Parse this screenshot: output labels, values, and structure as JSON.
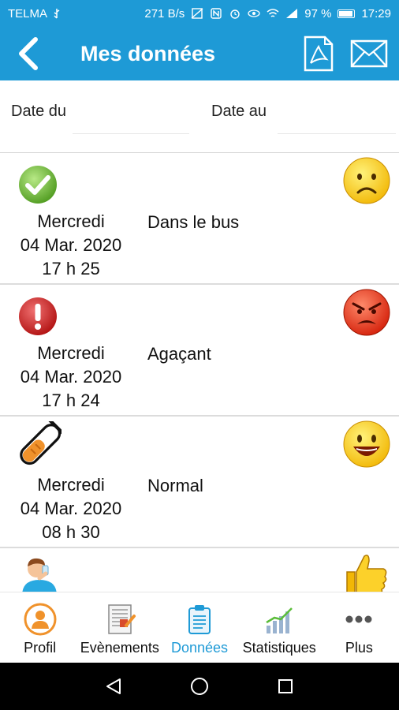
{
  "status_bar": {
    "carrier": "TELMA",
    "speed": "271 B/s",
    "battery_pct": "97 %",
    "time": "17:29"
  },
  "app_bar": {
    "title": "Mes données",
    "back_icon": "back-chevron-icon",
    "pdf_icon": "pdf-icon",
    "mail_icon": "mail-icon"
  },
  "filter": {
    "date_from_label": "Date du",
    "date_to_label": "Date au"
  },
  "entries": [
    {
      "icon": "checkmark-icon",
      "day": "Mercredi",
      "date": "04 Mar. 2020",
      "time": "17 h 25",
      "description": "Dans le bus",
      "mood": "sad-face-icon"
    },
    {
      "icon": "alert-icon",
      "day": "Mercredi",
      "date": "04 Mar. 2020",
      "time": "17 h 24",
      "description": "Agaçant",
      "mood": "angry-face-icon"
    },
    {
      "icon": "test-tube-icon",
      "day": "Mercredi",
      "date": "04 Mar. 2020",
      "time": "08 h 30",
      "description": "Normal",
      "mood": "happy-face-icon"
    }
  ],
  "partial_entry": {
    "icon": "drinking-person-icon",
    "mood": "thumbs-up-icon"
  },
  "bottom_nav": {
    "items": [
      {
        "label": "Profil",
        "icon": "profile-icon"
      },
      {
        "label": "Evènements",
        "icon": "events-icon"
      },
      {
        "label": "Données",
        "icon": "data-icon"
      },
      {
        "label": "Statistiques",
        "icon": "statistics-icon"
      },
      {
        "label": "Plus",
        "icon": "more-icon"
      }
    ],
    "active": "Données"
  },
  "colors": {
    "primary": "#1e9ad6",
    "active_tab": "#1e9ad6",
    "system_nav": "#000000"
  }
}
